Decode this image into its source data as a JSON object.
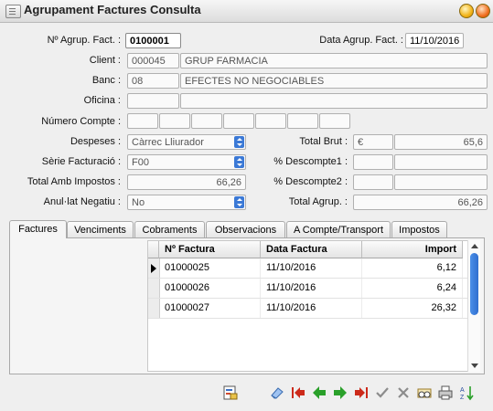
{
  "window": {
    "title": "Agrupament Factures Consulta"
  },
  "form": {
    "num_agrup_label": "Nº Agrup. Fact. :",
    "num_agrup_value": "0100001",
    "data_agrup_label": "Data Agrup. Fact. :",
    "data_agrup_value": "11/10/2016",
    "client_label": "Client :",
    "client_code": "000045",
    "client_name": "GRUP FARMACIA",
    "banc_label": "Banc :",
    "banc_code": "08",
    "banc_name": "EFECTES NO NEGOCIABLES",
    "oficina_label": "Oficina :",
    "oficina_code": "",
    "oficina_name": "",
    "numero_compte_label": "Número Compte :",
    "despeses_label": "Despeses :",
    "despeses_value": "Càrrec Lliurador",
    "serie_label": "Sèrie Facturació :",
    "serie_value": "F00",
    "total_amb_impostos_label": "Total Amb Impostos :",
    "total_amb_impostos_value": "66,26",
    "anulat_label": "Anul·lat Negatiu :",
    "anulat_value": "No",
    "total_brut_label": "Total Brut :",
    "total_brut_currency": "€",
    "total_brut_value": "65,6",
    "descompte1_label": "% Descompte1 :",
    "descompte2_label": "% Descompte2 :",
    "total_agrup_label": "Total Agrup. :",
    "total_agrup_value": "66,26"
  },
  "tabs": [
    "Factures",
    "Venciments",
    "Cobraments",
    "Observacions",
    "A Compte/Transport",
    "Impostos"
  ],
  "grid": {
    "columns": [
      "Nº Factura",
      "Data Factura",
      "Import"
    ],
    "rows": [
      [
        "01000025",
        "11/10/2016",
        "6,12"
      ],
      [
        "01000026",
        "11/10/2016",
        "6,24"
      ],
      [
        "01000027",
        "11/10/2016",
        "26,32"
      ]
    ]
  },
  "toolbar_icons": [
    "report-icon",
    "eraser-icon",
    "first-arrow-icon",
    "prev-arrow-icon",
    "next-arrow-icon",
    "last-arrow-icon",
    "accept-check-icon",
    "cancel-x-icon",
    "search-binoculars-icon",
    "print-icon",
    "sort-az-icon"
  ],
  "colors": {
    "title_bg": "#e6e6e6",
    "scroll_thumb": "#3b79d6",
    "arrow_red": "#cc2a1a",
    "arrow_green": "#2aa02a"
  }
}
